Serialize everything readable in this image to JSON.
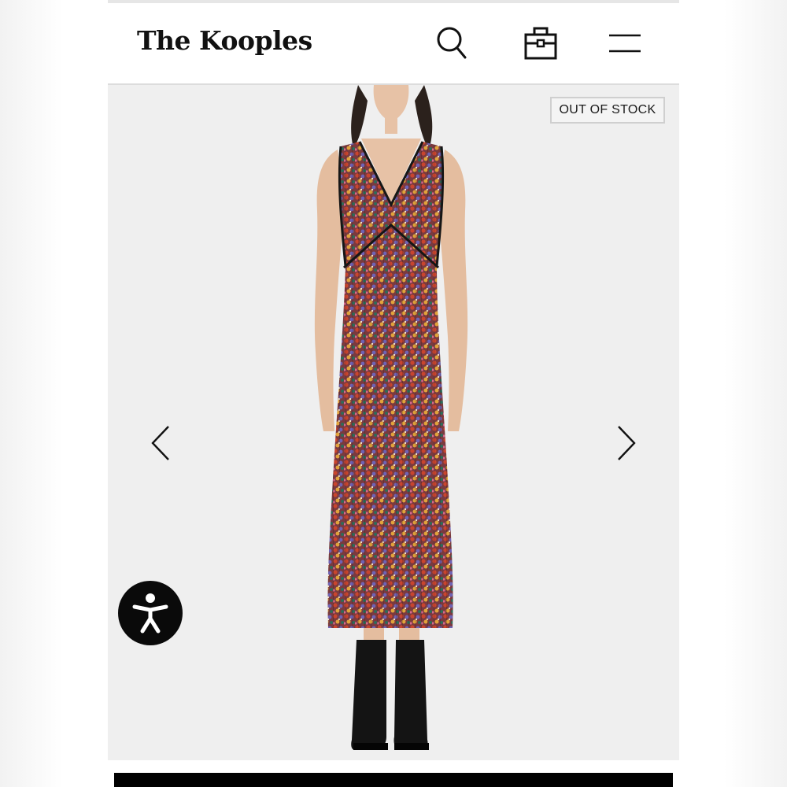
{
  "header": {
    "logo_text": "The Kooples",
    "icons": [
      "search-icon",
      "shopping-bag-icon",
      "menu-icon"
    ]
  },
  "product": {
    "stock_badge": "OUT OF STOCK",
    "image_alt": "Model wearing sleeveless V-neck multicolour floral pleated midi dress with black piping and black ankle boots"
  },
  "gallery": {
    "prev_icon": "chevron-left-icon",
    "next_icon": "chevron-right-icon"
  },
  "accessibility": {
    "icon": "accessibility-icon"
  },
  "colors": {
    "header_bg": "#ffffff",
    "gallery_bg": "#efefef",
    "text": "#111111",
    "badge_border": "#cfcfcf",
    "a11y_bg": "#0a0a0a"
  }
}
